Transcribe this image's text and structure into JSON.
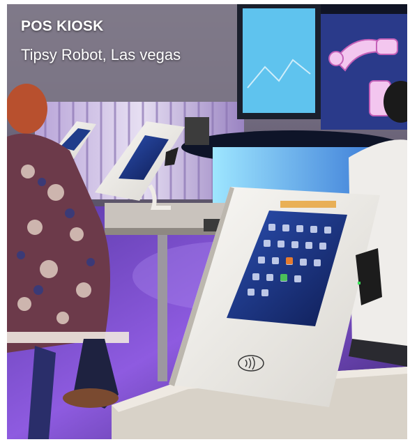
{
  "caption": {
    "title": "POS KIOSK",
    "subtitle": "Tipsy Robot, Las vegas"
  },
  "colors": {
    "wall": "#7a7488",
    "floor_glow": "#7f4bd6",
    "bar_light": "#5ec8ff",
    "kiosk_white": "#f2f0ec",
    "tablet_screen": "#1c2f7a",
    "robot_pink": "#f06fd6"
  }
}
